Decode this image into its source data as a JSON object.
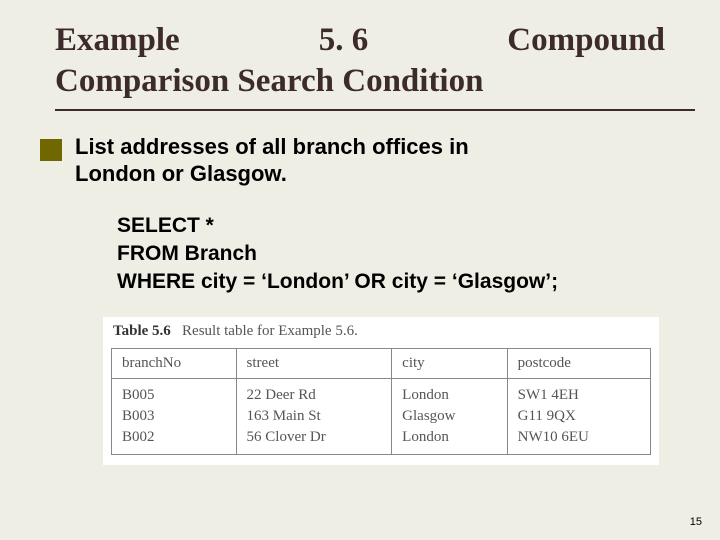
{
  "title": {
    "word1": "Example",
    "num": "5. 6",
    "word2": "Compound",
    "line2": "Comparison Search Condition"
  },
  "task": {
    "line1": "List addresses of all branch offices in",
    "line2": "London or Glasgow."
  },
  "sql": {
    "l1": "SELECT *",
    "l2": "FROM Branch",
    "l3": "WHERE city = ‘London’ OR city = ‘Glasgow’;"
  },
  "table": {
    "caption_bold": "Table 5.6",
    "caption_rest": "Result table for Example 5.6.",
    "headers": [
      "branchNo",
      "street",
      "city",
      "postcode"
    ],
    "rows": [
      [
        "B005",
        "22 Deer Rd",
        "London",
        "SW1 4EH"
      ],
      [
        "B003",
        "163 Main St",
        "Glasgow",
        "G11 9QX"
      ],
      [
        "B002",
        "56 Clover Dr",
        "London",
        "NW10 6EU"
      ]
    ]
  },
  "page": "15",
  "chart_data": {
    "type": "table",
    "title": "Table 5.6 Result table for Example 5.6.",
    "columns": [
      "branchNo",
      "street",
      "city",
      "postcode"
    ],
    "rows": [
      [
        "B005",
        "22 Deer Rd",
        "London",
        "SW1 4EH"
      ],
      [
        "B003",
        "163 Main St",
        "Glasgow",
        "G11 9QX"
      ],
      [
        "B002",
        "56 Clover Dr",
        "London",
        "NW10 6EU"
      ]
    ]
  }
}
